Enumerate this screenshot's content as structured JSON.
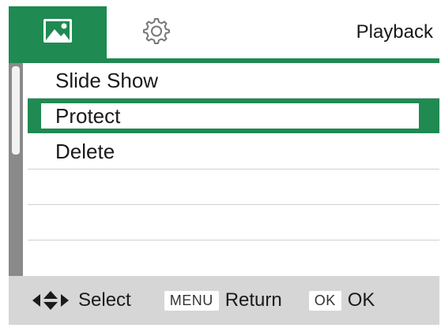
{
  "header": {
    "title": "Playback",
    "tabs": [
      {
        "icon": "image-icon",
        "selected": true
      },
      {
        "icon": "gear-icon",
        "selected": false
      }
    ]
  },
  "menu": {
    "items": [
      {
        "label": "Slide Show"
      },
      {
        "label": "Protect",
        "selected": true
      },
      {
        "label": "Delete"
      }
    ]
  },
  "footer": {
    "select_label": "Select",
    "menu_key": "MENU",
    "return_label": "Return",
    "ok_key": "OK",
    "ok_label": "OK"
  },
  "colors": {
    "accent": "#1f8a52",
    "footer_bg": "#d6d6d6",
    "scrollbar": "#8a8a8a"
  }
}
